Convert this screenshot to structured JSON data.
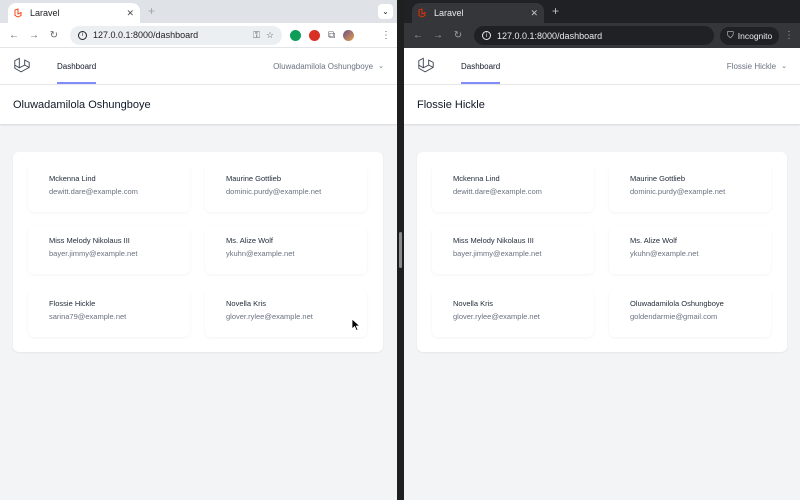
{
  "colors": {
    "accent": "#818cf8",
    "laravel_red": "#f53003",
    "page_bg": "#f3f4f6"
  },
  "left_window": {
    "tab": {
      "title": "Laravel",
      "favicon": "laravel-icon"
    },
    "address": {
      "url": "127.0.0.1:8000/dashboard"
    },
    "nav": {
      "dashboard_label": "Dashboard",
      "user_label": "Oluwadamilola Oshungboye"
    },
    "header_title": "Oluwadamilola Oshungboye",
    "users": [
      {
        "name": "Mckenna Lind",
        "email": "dewitt.dare@example.com"
      },
      {
        "name": "Maurine Gottlieb",
        "email": "dominic.purdy@example.net"
      },
      {
        "name": "Miss Melody Nikolaus III",
        "email": "bayer.jimmy@example.net"
      },
      {
        "name": "Ms. Alize Wolf",
        "email": "ykuhn@example.net"
      },
      {
        "name": "Flossie Hickle",
        "email": "sarina79@example.net"
      },
      {
        "name": "Novella Kris",
        "email": "glover.rylee@example.net"
      }
    ]
  },
  "right_window": {
    "tab": {
      "title": "Laravel",
      "favicon": "laravel-icon"
    },
    "address": {
      "url": "127.0.0.1:8000/dashboard",
      "incognito_label": "Incognito"
    },
    "nav": {
      "dashboard_label": "Dashboard",
      "user_label": "Flossie Hickle"
    },
    "header_title": "Flossie Hickle",
    "users": [
      {
        "name": "Mckenna Lind",
        "email": "dewitt.dare@example.com"
      },
      {
        "name": "Maurine Gottlieb",
        "email": "dominic.purdy@example.net"
      },
      {
        "name": "Miss Melody Nikolaus III",
        "email": "bayer.jimmy@example.net"
      },
      {
        "name": "Ms. Alize Wolf",
        "email": "ykuhn@example.net"
      },
      {
        "name": "Novella Kris",
        "email": "glover.rylee@example.net"
      },
      {
        "name": "Oluwadamilola Oshungboye",
        "email": "goldendarmie@gmail.com"
      }
    ]
  }
}
